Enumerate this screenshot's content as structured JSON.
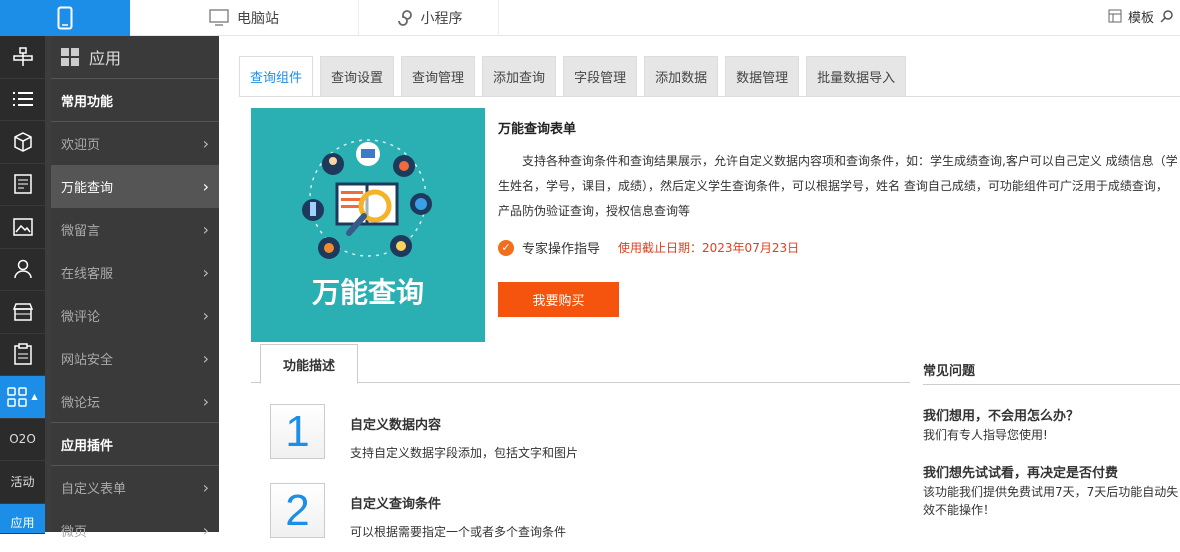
{
  "topbar": {
    "tabs": [
      {
        "label": "电脑站",
        "icon": "monitor-icon"
      },
      {
        "label": "小程序",
        "icon": "mini-program-icon"
      }
    ],
    "template_label": "模板"
  },
  "rail": {
    "text_items": [
      "O2O",
      "活动",
      "应用"
    ]
  },
  "sidebar": {
    "header": "应用",
    "group1": "常用功能",
    "items1": [
      {
        "label": "欢迎页"
      },
      {
        "label": "万能查询"
      },
      {
        "label": "微留言"
      },
      {
        "label": "在线客服"
      },
      {
        "label": "微评论"
      },
      {
        "label": "网站安全"
      },
      {
        "label": "微论坛"
      }
    ],
    "group2": "应用插件",
    "items2": [
      {
        "label": "自定义表单"
      },
      {
        "label": "微页"
      }
    ]
  },
  "tabs": [
    "查询组件",
    "查询设置",
    "查询管理",
    "添加查询",
    "字段管理",
    "添加数据",
    "数据管理",
    "批量数据导入"
  ],
  "hero": {
    "title": "万能查询"
  },
  "info": {
    "title": "万能查询表单",
    "desc": "支持各种查询条件和查询结果展示，允许自定义数据内容项和查询条件，如：学生成绩查询,客户可以自己定义 成绩信息（学生姓名，学号，课目，成绩），然后定义学生查询条件，可以根据学号，姓名 查询自己成绩，可功能组件可广泛用于成绩查询，产品防伪验证查询，授权信息查询等",
    "guide": "专家操作指导",
    "expire": "使用截止日期：2023年07月23日",
    "buy_label": "我要购买"
  },
  "features": {
    "tab_label": "功能描述",
    "items": [
      {
        "num": "1",
        "title": "自定义数据内容",
        "desc": "支持自定义数据字段添加，包括文字和图片"
      },
      {
        "num": "2",
        "title": "自定义查询条件",
        "desc": "可以根据需要指定一个或者多个查询条件"
      }
    ]
  },
  "faq": {
    "title": "常见问题",
    "items": [
      {
        "q": "我们想用，不会用怎么办？",
        "a": "我们有专人指导您使用!"
      },
      {
        "q": "我们想先试试看，再决定是否付费",
        "a": "该功能我们提供免费试用7天，7天后功能自动失效不能操作！"
      }
    ]
  },
  "colors": {
    "accent": "#1c8ee8",
    "buy": "#f5540e",
    "hero_bg": "#2ab0b2",
    "expire": "#e33f1e"
  }
}
